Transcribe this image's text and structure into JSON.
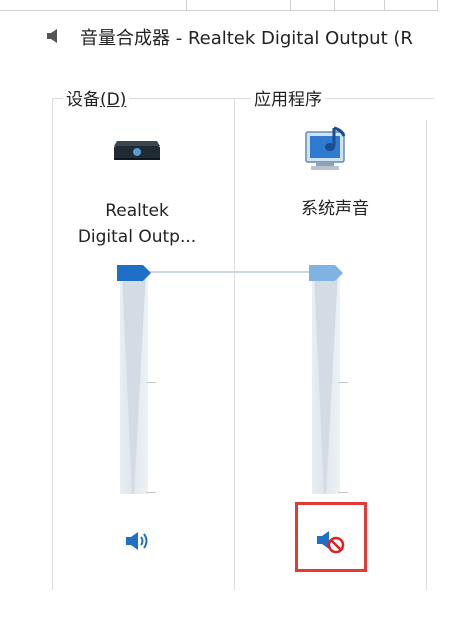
{
  "window": {
    "title": "音量合成器 - Realtek Digital Output (R"
  },
  "devices_section": {
    "label_text": "设备",
    "label_mnemonic": "(D)",
    "device_name_line1": "Realtek",
    "device_name_line2": "Digital Outp...",
    "device_icon": "speaker-device-icon",
    "mute_icon": "speaker-volume-icon",
    "volume_percent": 100
  },
  "apps_section": {
    "label": "应用程序",
    "app_name": "系统声音",
    "app_icon": "system-sounds-icon",
    "mute_icon": "speaker-muted-icon",
    "volume_percent": 100,
    "muted": true
  },
  "colors": {
    "accent": "#1e6fc6",
    "highlight": "#e53935"
  }
}
